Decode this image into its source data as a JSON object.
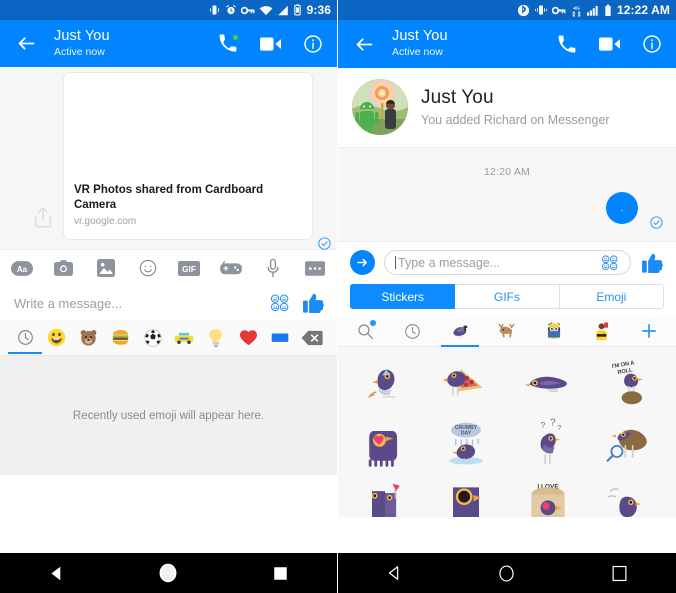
{
  "left": {
    "statusbar": {
      "icons": [
        "vibrate-icon",
        "alarm-icon",
        "vpn-key-icon",
        "wifi-icon",
        "signal-icon",
        "battery-icon"
      ],
      "time": "9:36"
    },
    "appbar": {
      "back_label": "back-arrow",
      "title": "Just You",
      "subtitle": "Active now",
      "actions": [
        "call-icon",
        "video-icon",
        "info-icon"
      ]
    },
    "attachment_card": {
      "title": "VR Photos shared from Cardboard Camera",
      "url": "vr.google.com",
      "share_icon": "share-icon",
      "delivered_icon": "delivered-check-icon"
    },
    "composer": {
      "tools": [
        "text-format-aa-icon",
        "camera-icon",
        "gallery-icon",
        "emoji-icon",
        "gif-icon",
        "games-icon",
        "microphone-icon",
        "more-icon"
      ],
      "placeholder": "Write a message...",
      "emoji_picker_icon": "emoji-picker-icon",
      "like_icon": "thumbs-up-icon"
    },
    "emoji_keyboard": {
      "tabs": [
        {
          "name": "recent-tab",
          "glyph": "\u0000clock",
          "selected": true
        },
        {
          "name": "smileys-tab",
          "glyph": "😃",
          "selected": false
        },
        {
          "name": "animals-tab",
          "glyph": "🐻",
          "selected": false
        },
        {
          "name": "food-tab",
          "glyph": "🍔",
          "selected": false
        },
        {
          "name": "sports-tab",
          "glyph": "⚽",
          "selected": false
        },
        {
          "name": "travel-tab",
          "glyph": "🚕",
          "selected": false
        },
        {
          "name": "objects-tab",
          "glyph": "💡",
          "selected": false
        },
        {
          "name": "symbols-tab",
          "glyph": "❤️",
          "selected": false
        },
        {
          "name": "flags-tab",
          "glyph": "🚩",
          "selected": false
        },
        {
          "name": "backspace-tab",
          "glyph": "\u0000backspace",
          "selected": false
        }
      ],
      "empty_text": "Recently used emoji will appear here."
    },
    "navbar": [
      "back-nav-button",
      "home-nav-button",
      "recents-nav-button"
    ]
  },
  "right": {
    "statusbar": {
      "icons": [
        "bluetooth-icon",
        "vibrate-icon",
        "vpn-key-icon",
        "network-4g-icon",
        "signal-icon",
        "battery-icon"
      ],
      "time": "12:22 AM"
    },
    "appbar": {
      "back_label": "back-arrow",
      "title": "Just You",
      "subtitle": "Active now",
      "actions": [
        "call-icon",
        "video-icon",
        "info-icon"
      ]
    },
    "profile": {
      "avatar": "android-lollipop-statue-photo",
      "name": "Just You",
      "subtitle": "You added Richard on Messenger"
    },
    "conversation": {
      "timestamp": "12:20 AM",
      "bubble_text": ".",
      "delivered_icon": "delivered-check-icon"
    },
    "composer": {
      "send_icon": "send-arrow-icon",
      "placeholder": "Type a message...",
      "emoji_picker_icon": "emoji-picker-icon",
      "like_icon": "thumbs-up-icon"
    },
    "segmented": [
      {
        "label": "Stickers",
        "selected": true
      },
      {
        "label": "GIFs",
        "selected": false
      },
      {
        "label": "Emoji",
        "selected": false
      }
    ],
    "sticker_keyboard": {
      "tabs": [
        {
          "name": "sticker-search-tab",
          "glyph": "\u0000search",
          "badge": true,
          "selected": false
        },
        {
          "name": "sticker-recent-tab",
          "glyph": "\u0000clock",
          "badge": false,
          "selected": false
        },
        {
          "name": "sticker-pack-pigeon-tab",
          "glyph": "🕊️",
          "badge": false,
          "selected": true
        },
        {
          "name": "sticker-pack-deer-tab",
          "glyph": "🦌",
          "badge": false,
          "selected": false
        },
        {
          "name": "sticker-pack-minion-tab",
          "glyph": "👶",
          "badge": false,
          "selected": false
        },
        {
          "name": "sticker-pack-referee-tab",
          "glyph": "🙅",
          "badge": false,
          "selected": false
        },
        {
          "name": "sticker-store-add-tab",
          "glyph": "\u0000plus",
          "badge": false,
          "selected": false
        }
      ],
      "stickers": [
        {
          "name": "pigeon-party-hat-sticker",
          "caption": ""
        },
        {
          "name": "pigeon-pizza-wings-sticker",
          "caption": ""
        },
        {
          "name": "pigeon-lying-flat-sticker",
          "caption": ""
        },
        {
          "name": "pigeon-on-rock-sticker",
          "caption": "I'M ON A ROLL"
        },
        {
          "name": "pigeon-heart-eyes-sticker",
          "caption": ""
        },
        {
          "name": "pigeon-rain-cloud-sticker",
          "caption": "CRUMBY DAY"
        },
        {
          "name": "pigeon-confused-sticker",
          "caption": ""
        },
        {
          "name": "pigeon-magnifying-glass-sticker",
          "caption": ""
        },
        {
          "name": "pigeon-cocktail-sticker",
          "caption": ""
        },
        {
          "name": "pigeon-hole-sticker",
          "caption": ""
        },
        {
          "name": "pigeon-bread-sticker",
          "caption": "I LOVE"
        },
        {
          "name": "pigeon-running-sticker",
          "caption": ""
        }
      ]
    },
    "navbar": [
      "back-nav-button",
      "home-nav-button",
      "recents-nav-button"
    ]
  }
}
